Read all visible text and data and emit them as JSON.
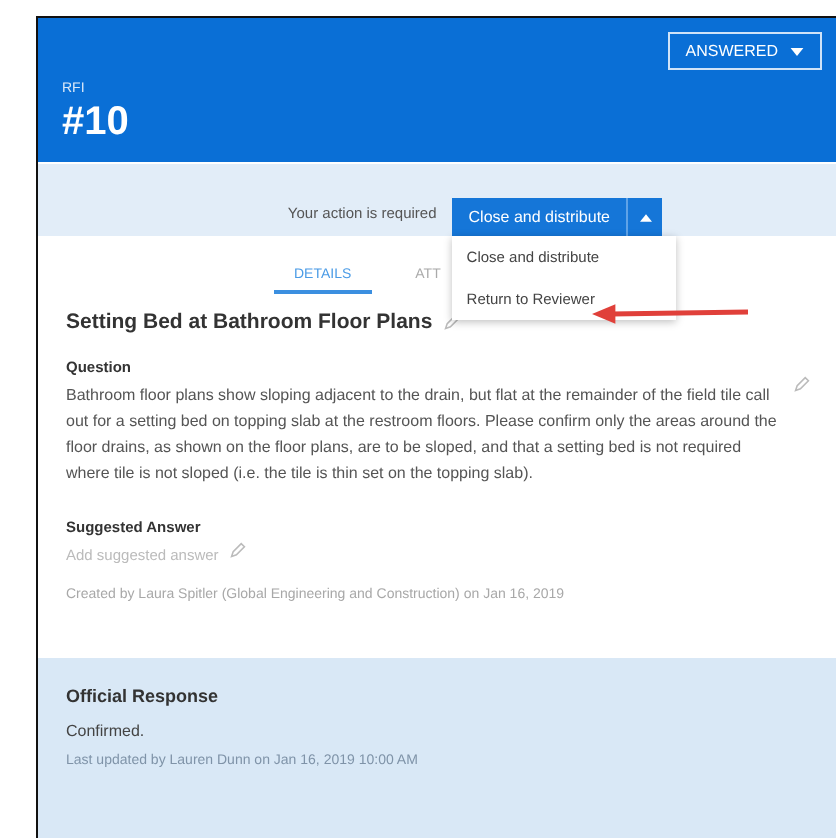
{
  "header": {
    "status_button": "ANSWERED",
    "label": "RFI",
    "number": "#10"
  },
  "action_bar": {
    "prompt": "Your action is required",
    "primary_button": "Close and distribute"
  },
  "action_menu": {
    "items": [
      {
        "label": "Close and distribute"
      },
      {
        "label": "Return to Reviewer"
      }
    ]
  },
  "tabs": [
    {
      "label": "DETAILS",
      "selected": true
    },
    {
      "label": "ATT",
      "selected": false
    }
  ],
  "details": {
    "title": "Setting Bed at Bathroom Floor Plans",
    "question_label": "Question",
    "question": "Bathroom floor plans show sloping adjacent to the drain, but flat at the remainder of the field tile call out for a setting bed on topping slab at the restroom floors. Please confirm only the areas around the floor drains, as shown on the floor plans, are to be sloped, and that a setting bed is not required where tile is not sloped (i.e. the tile is thin set on the topping slab).",
    "suggested_label": "Suggested Answer",
    "suggested_placeholder": "Add suggested answer",
    "created": "Created by Laura Spitler (Global Engineering and Construction) on Jan 16, 2019"
  },
  "official_response": {
    "title": "Official Response",
    "text": "Confirmed.",
    "updated": "Last updated by Lauren Dunn on Jan 16, 2019 10:00 AM"
  }
}
